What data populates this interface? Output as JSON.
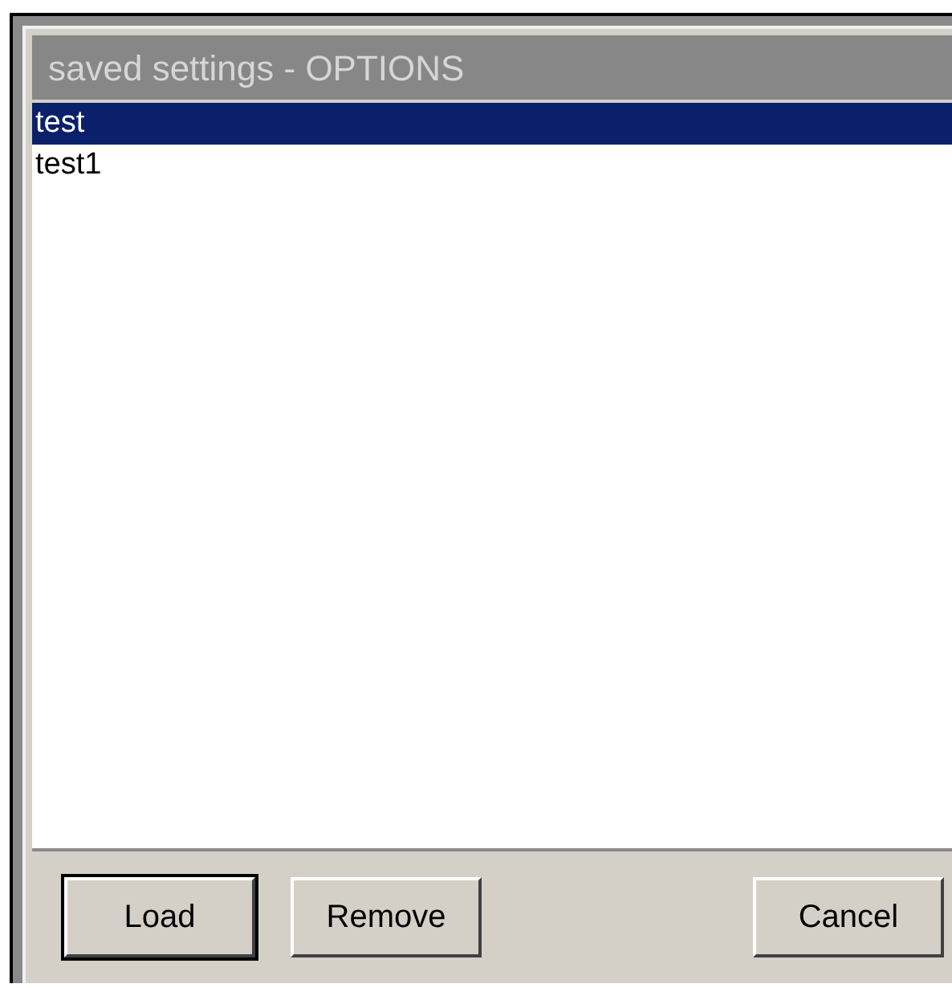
{
  "dialog": {
    "title": "saved settings - OPTIONS"
  },
  "list": {
    "items": [
      {
        "label": "test",
        "selected": true
      },
      {
        "label": "test1",
        "selected": false
      }
    ]
  },
  "buttons": [
    {
      "label": "Load",
      "default": true
    },
    {
      "label": "Remove",
      "default": false
    },
    {
      "label": "Cancel",
      "default": false
    }
  ]
}
